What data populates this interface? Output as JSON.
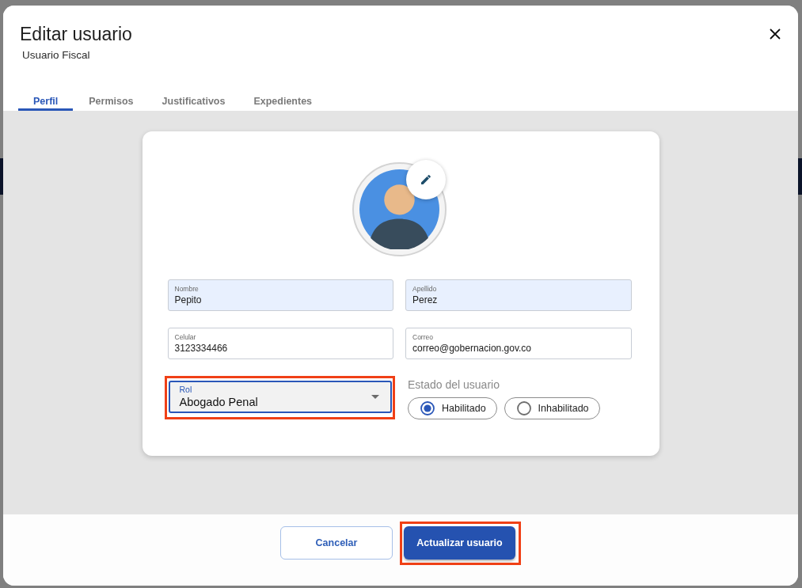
{
  "window": {
    "title": "Editar usuario",
    "subtitle": "Usuario Fiscal"
  },
  "tabs": [
    {
      "label": "Perfil",
      "selected": true
    },
    {
      "label": "Permisos",
      "selected": false
    },
    {
      "label": "Justificativos",
      "selected": false
    },
    {
      "label": "Expedientes",
      "selected": false
    }
  ],
  "profile": {
    "fields": [
      {
        "kind": "autofill",
        "label": "Nombre",
        "value": "Pepito",
        "focused": false,
        "highlighted": false
      },
      {
        "kind": "autofill",
        "label": "Apellido",
        "value": "Perez",
        "focused": false,
        "highlighted": false
      },
      {
        "kind": "text",
        "label": "Celular",
        "value": "3123334466",
        "focused": false,
        "highlighted": false
      },
      {
        "kind": "text",
        "label": "Correo",
        "value": "correo@gobernacion.gov.co",
        "focused": false,
        "highlighted": false
      },
      {
        "kind": "select",
        "label": "Rol",
        "value": "Abogado Penal",
        "focused": true,
        "highlighted": true
      }
    ],
    "status": {
      "label": "Estado del usuario",
      "options": [
        {
          "label": "Habilitado",
          "selected": true
        },
        {
          "label": "Inhabilitado",
          "selected": false
        }
      ]
    }
  },
  "buttons": [
    {
      "label": "Cancelar",
      "kind": "secondary",
      "highlighted": false
    },
    {
      "label": "Actualizar usuario",
      "kind": "primary",
      "highlighted": true
    }
  ]
}
